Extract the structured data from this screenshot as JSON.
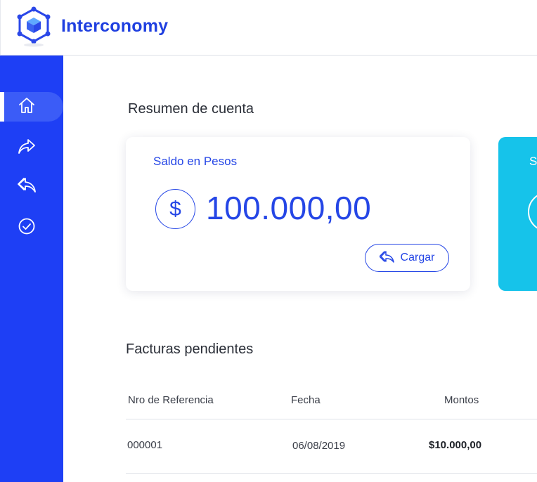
{
  "header": {
    "brand": "Interconomy",
    "logo_icon": "cube-network-icon"
  },
  "sidebar": {
    "items": [
      {
        "name": "home",
        "icon": "home-icon",
        "active": true
      },
      {
        "name": "send",
        "icon": "share-forward-icon",
        "active": false
      },
      {
        "name": "receive",
        "icon": "reply-back-icon",
        "active": false
      },
      {
        "name": "approved",
        "icon": "check-circle-icon",
        "active": false
      }
    ]
  },
  "summary": {
    "title": "Resumen de cuenta",
    "card": {
      "label": "Saldo en Pesos",
      "currency_symbol": "$",
      "amount": "100.000,00",
      "button_label": "Cargar"
    },
    "card2": {
      "label": "S"
    }
  },
  "invoices": {
    "title": "Facturas pendientes",
    "columns": [
      "Nro de Referencia",
      "Fecha",
      "Montos"
    ],
    "rows": [
      {
        "ref": "000001",
        "date": "06/08/2019",
        "amount": "$10.000,00"
      }
    ]
  },
  "colors": {
    "primary": "#1e3ff5",
    "accent_text": "#2546e6",
    "secondary_card": "#16c3ea"
  }
}
